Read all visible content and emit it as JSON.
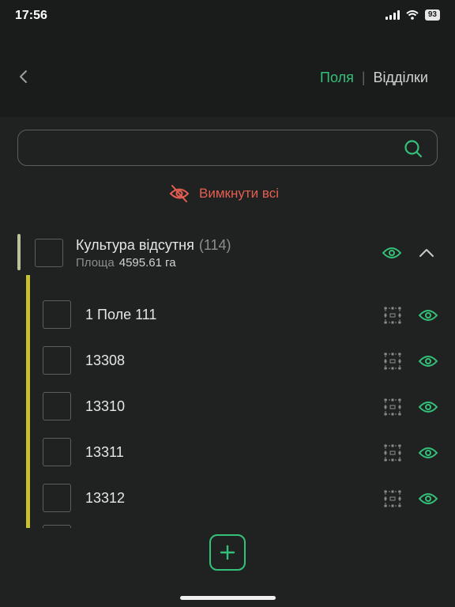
{
  "status_bar": {
    "time": "17:56",
    "battery": "93"
  },
  "header": {
    "tab_fields": "Поля",
    "tab_sections": "Відділки"
  },
  "search": {
    "value": "",
    "placeholder": ""
  },
  "disable_all_label": "Вимкнути всі",
  "group": {
    "title": "Культура відсутня",
    "count": "(114)",
    "area_label": "Площа",
    "area_value": "4595.61 га"
  },
  "fields": [
    {
      "name": "1 Поле 111"
    },
    {
      "name": "13308"
    },
    {
      "name": "13310"
    },
    {
      "name": "13311"
    },
    {
      "name": "13312"
    }
  ],
  "colors": {
    "accent": "#35c07a",
    "danger": "#e65e52",
    "group_bar": "#c9c12e"
  }
}
